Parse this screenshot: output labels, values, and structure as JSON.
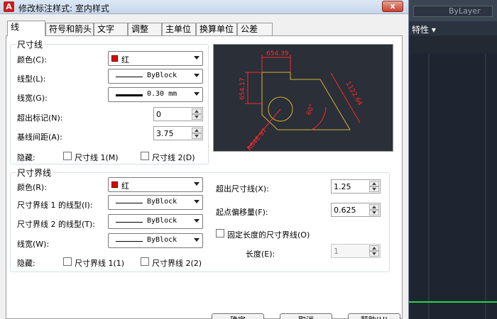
{
  "dialog": {
    "title": "修改标注样式: 室内样式",
    "close_label": "x"
  },
  "tabs": [
    {
      "label": "线"
    },
    {
      "label": "符号和箭头"
    },
    {
      "label": "文字"
    },
    {
      "label": "调整"
    },
    {
      "label": "主单位"
    },
    {
      "label": "换算单位"
    },
    {
      "label": "公差"
    }
  ],
  "dim_lines": {
    "group_label": "尺寸线",
    "color_label": "颜色(C):",
    "color_value": "红",
    "linetype_label": "线型(L):",
    "linetype_value": "ByBlock",
    "lineweight_label": "线宽(G):",
    "lineweight_value": "0.30 mm",
    "extend_label": "超出标记(N):",
    "extend_value": "0",
    "baseline_label": "基线间距(A):",
    "baseline_value": "3.75",
    "suppress_label": "隐藏:",
    "suppress1_label": "尺寸线 1(M)",
    "suppress2_label": "尺寸线 2(D)"
  },
  "ext_lines": {
    "group_label": "尺寸界线",
    "color_label": "颜色(R):",
    "color_value": "红",
    "lt1_label": "尺寸界线 1 的线型(I):",
    "lt1_value": "ByBlock",
    "lt2_label": "尺寸界线 2 的线型(T):",
    "lt2_value": "ByBlock",
    "lw_label": "线宽(W):",
    "lw_value": "ByBlock",
    "suppress_label": "隐藏:",
    "suppress1_label": "尺寸界线 1(1)",
    "suppress2_label": "尺寸界线 2(2)",
    "beyond_label": "超出尺寸线(X):",
    "beyond_value": "1.25",
    "offset_label": "起点偏移量(F):",
    "offset_value": "0.625",
    "fixed_label": "固定长度的尺寸界线(O)",
    "length_label": "长度(E):",
    "length_value": "1"
  },
  "preview": {
    "dim_top": "654.39",
    "dim_left": "654.17",
    "dim_right": "1122.64",
    "dim_radius": "R646.97",
    "dim_angle": "60°",
    "dim_color": "#ff2a2a",
    "geom_color": "#d6b43a"
  },
  "buttons": {
    "ok": "确定",
    "cancel": "取消",
    "help": "帮助(H)"
  },
  "cad": {
    "bylayer": "ByLayer",
    "properties": "特性 ▾"
  }
}
